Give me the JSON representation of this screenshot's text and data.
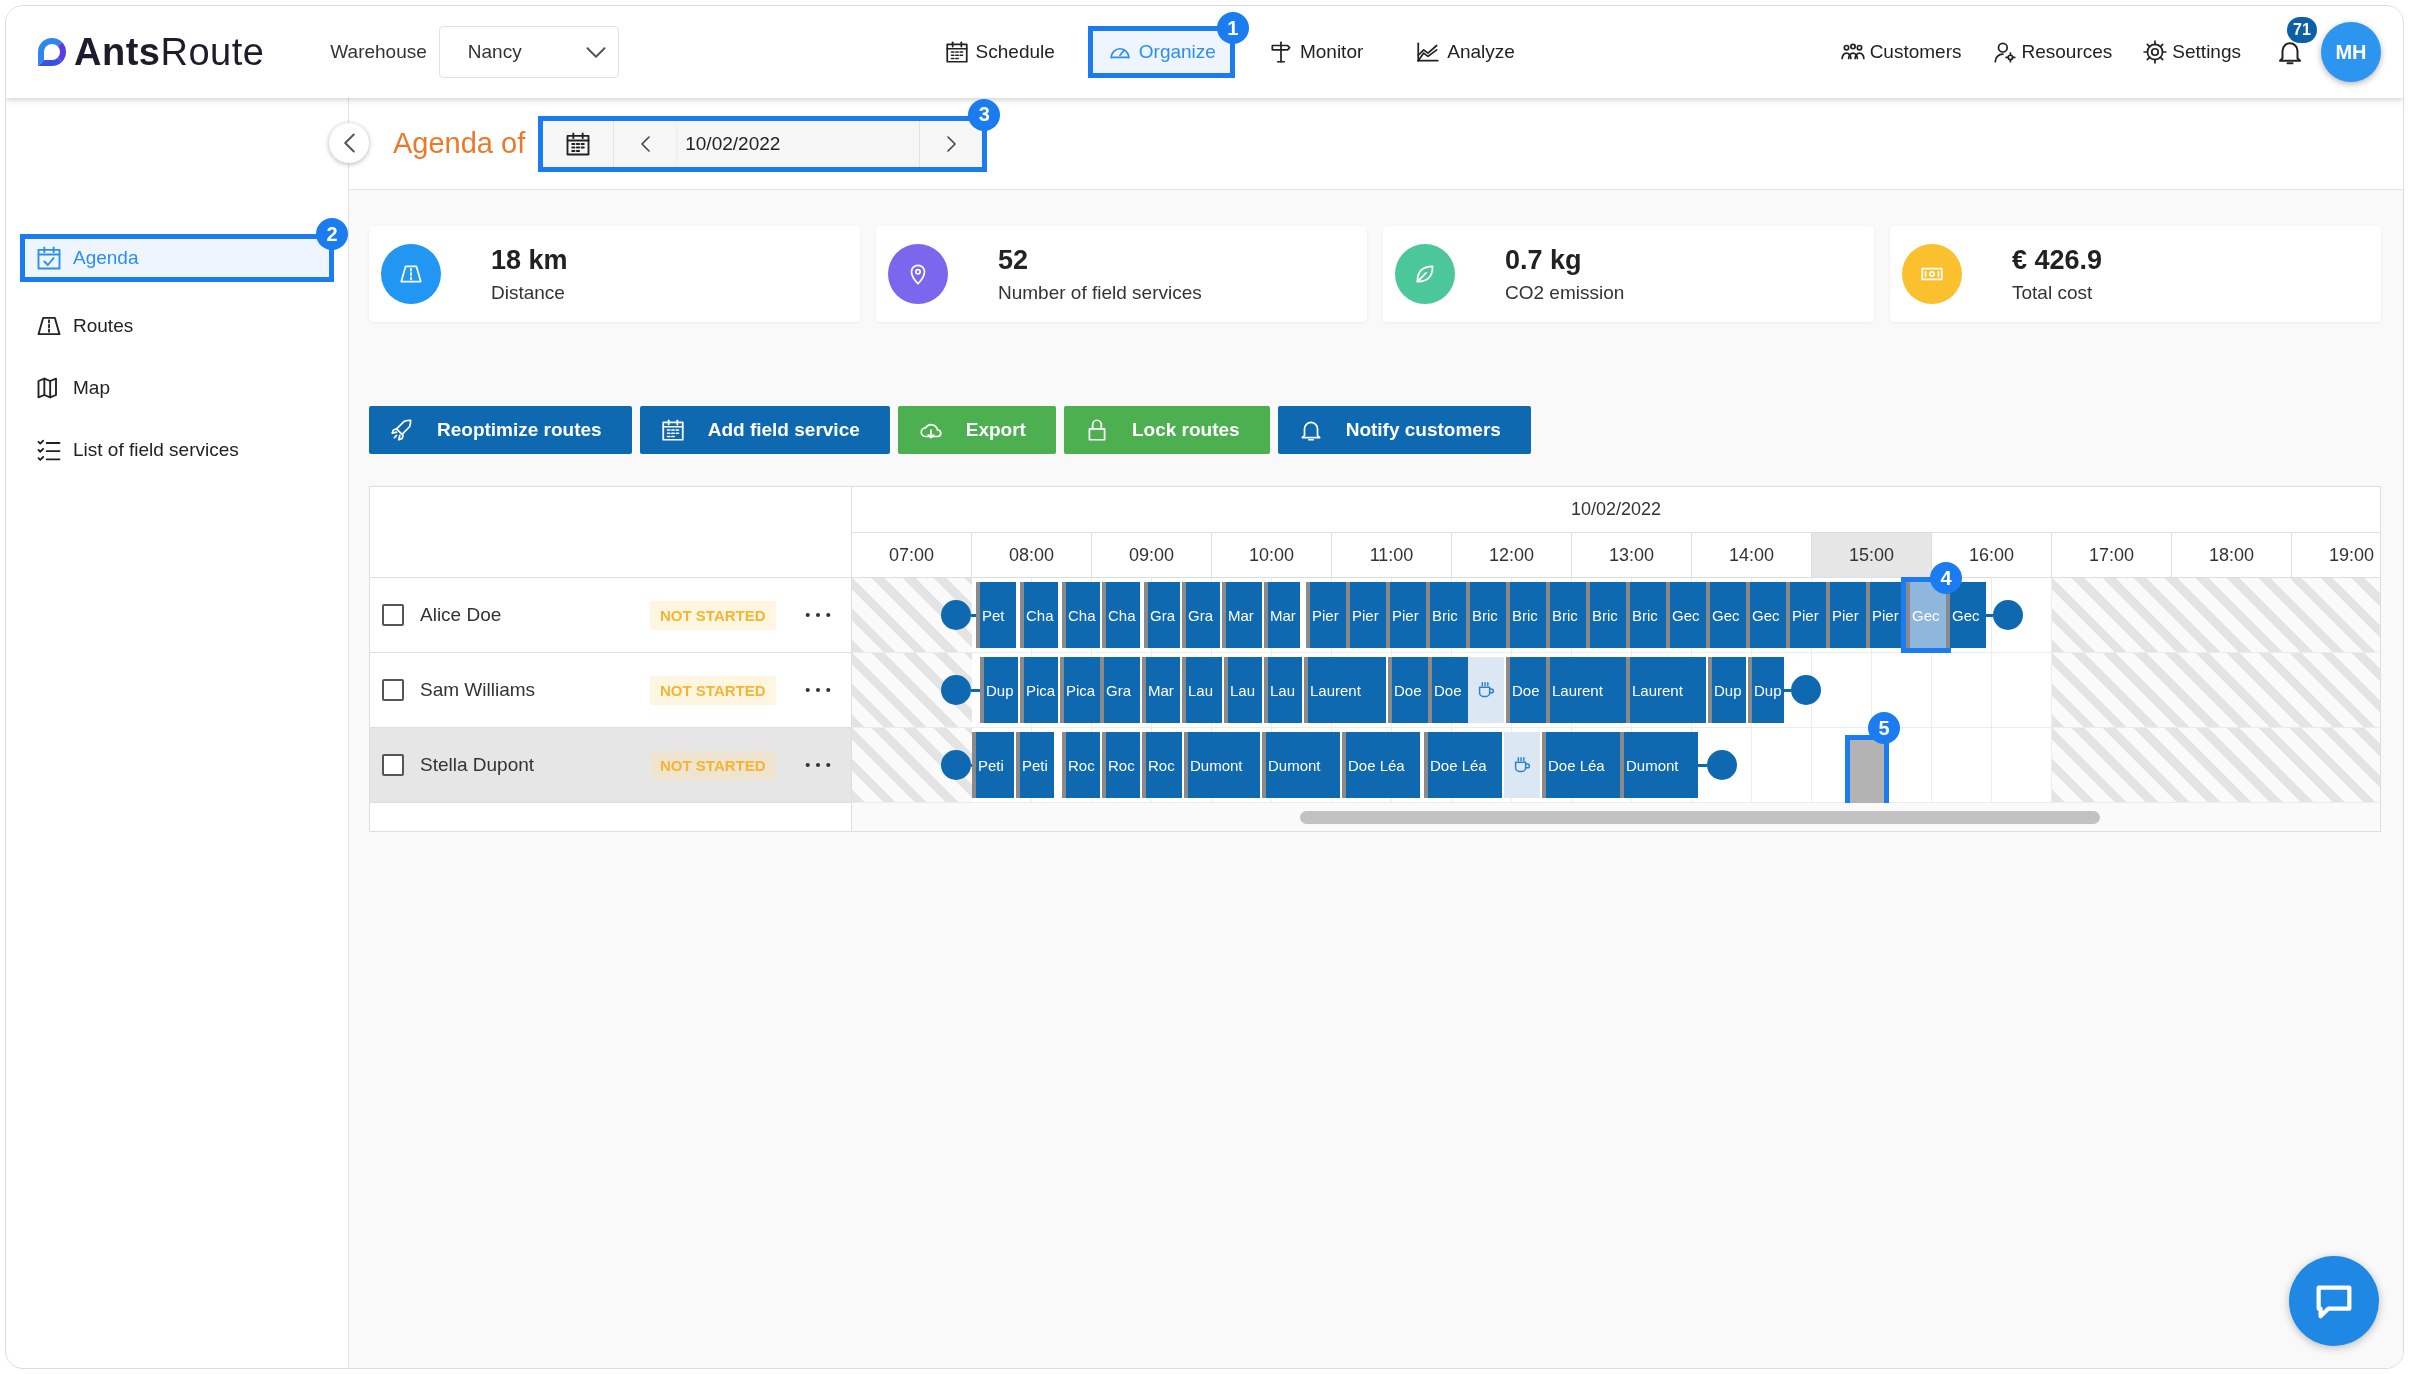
{
  "header": {
    "logo": "**Ants**Route",
    "warehouse": {
      "label": "Warehouse",
      "value": "Nancy"
    },
    "nav": [
      {
        "label": "Schedule",
        "selected": false
      },
      {
        "label": "Organize",
        "selected": true,
        "callout": "1"
      },
      {
        "label": "Monitor",
        "selected": false
      },
      {
        "label": "Analyze",
        "selected": false
      }
    ],
    "tools": [
      {
        "label": "Customers"
      },
      {
        "label": "Resources"
      },
      {
        "label": "Settings"
      }
    ],
    "notifications": "71",
    "avatar": "MH"
  },
  "sidebar": {
    "items": [
      {
        "label": "Agenda",
        "selected": true,
        "callout": "2"
      },
      {
        "label": "Routes",
        "selected": false
      },
      {
        "label": "Map",
        "selected": false
      },
      {
        "label": "List of field services",
        "selected": false
      }
    ]
  },
  "agenda": {
    "title": "Agenda of",
    "date": "10/02/2022",
    "callout": "3"
  },
  "stats": [
    {
      "value": "18 km",
      "label": "Distance",
      "color": "#2196f3"
    },
    {
      "value": "52",
      "label": "Number of field services",
      "color": "#7a67ee"
    },
    {
      "value": "0.7 kg",
      "label": "CO2 emission",
      "color": "#4cc79a"
    },
    {
      "value": "€ 426.9",
      "label": "Total cost",
      "color": "#fbc02d"
    }
  ],
  "actions": [
    {
      "label": "Reoptimize routes",
      "kind": "primary"
    },
    {
      "label": "Add field service",
      "kind": "primary"
    },
    {
      "label": "Export",
      "kind": "success"
    },
    {
      "label": "Lock routes",
      "kind": "success"
    },
    {
      "label": "Notify customers",
      "kind": "primary"
    }
  ],
  "timeline": {
    "date": "10/02/2022",
    "hours": [
      {
        "label": "07:00",
        "selected": false
      },
      {
        "label": "08:00",
        "selected": false
      },
      {
        "label": "09:00",
        "selected": false
      },
      {
        "label": "10:00",
        "selected": false
      },
      {
        "label": "11:00",
        "selected": false
      },
      {
        "label": "12:00",
        "selected": false
      },
      {
        "label": "13:00",
        "selected": false
      },
      {
        "label": "14:00",
        "selected": false
      },
      {
        "label": "15:00",
        "selected": true
      },
      {
        "label": "16:00",
        "selected": false
      },
      {
        "label": "17:00",
        "selected": false
      },
      {
        "label": "18:00",
        "selected": false
      },
      {
        "label": "19:00",
        "selected": false
      }
    ],
    "rows": [
      {
        "name": "Alice Doe",
        "status": "NOT STARTED",
        "checked": false,
        "selected": false,
        "stops": [
          {
            "label": "Pet",
            "kind": "visit"
          },
          {
            "label": "Cha",
            "kind": "visit"
          },
          {
            "label": "Cha",
            "kind": "visit"
          },
          {
            "label": "Cha",
            "kind": "visit"
          },
          {
            "label": "Gra",
            "kind": "visit"
          },
          {
            "label": "Gra",
            "kind": "visit"
          },
          {
            "label": "Mar",
            "kind": "visit"
          },
          {
            "label": "Mar",
            "kind": "visit"
          },
          {
            "label": "Pier",
            "kind": "visit"
          },
          {
            "label": "Pier",
            "kind": "visit"
          },
          {
            "label": "Pier",
            "kind": "visit"
          },
          {
            "label": "Bric",
            "kind": "visit"
          },
          {
            "label": "Bric",
            "kind": "visit"
          },
          {
            "label": "Bric",
            "kind": "visit"
          },
          {
            "label": "Bric",
            "kind": "visit"
          },
          {
            "label": "Bric",
            "kind": "visit"
          },
          {
            "label": "Bric",
            "kind": "visit"
          },
          {
            "label": "Gec",
            "kind": "visit"
          },
          {
            "label": "Gec",
            "kind": "visit"
          },
          {
            "label": "Gec",
            "kind": "visit"
          },
          {
            "label": "Pier",
            "kind": "visit"
          },
          {
            "label": "Pier",
            "kind": "visit"
          },
          {
            "label": "Pier",
            "kind": "visit"
          },
          {
            "label": "Gec",
            "kind": "highlight",
            "callout": "4"
          },
          {
            "label": "Gec",
            "kind": "visit"
          }
        ]
      },
      {
        "name": "Sam Williams",
        "status": "NOT STARTED",
        "checked": false,
        "selected": false,
        "stops": [
          {
            "label": "Dup",
            "kind": "visit"
          },
          {
            "label": "Pica",
            "kind": "visit"
          },
          {
            "label": "Pica",
            "kind": "visit"
          },
          {
            "label": "Gra",
            "kind": "visit"
          },
          {
            "label": "Mar",
            "kind": "visit"
          },
          {
            "label": "Lau",
            "kind": "visit"
          },
          {
            "label": "Lau",
            "kind": "visit"
          },
          {
            "label": "Lau",
            "kind": "visit"
          },
          {
            "label": "Laurent",
            "kind": "visit"
          },
          {
            "label": "Doe",
            "kind": "visit"
          },
          {
            "label": "Doe",
            "kind": "visit"
          },
          {
            "kind": "break"
          },
          {
            "label": "Doe",
            "kind": "visit"
          },
          {
            "label": "Laurent",
            "kind": "visit"
          },
          {
            "label": "Laurent",
            "kind": "visit"
          },
          {
            "label": "Dup",
            "kind": "visit"
          },
          {
            "label": "Dup",
            "kind": "visit"
          }
        ]
      },
      {
        "name": "Stella Dupont",
        "status": "NOT STARTED",
        "checked": false,
        "selected": true,
        "stops": [
          {
            "label": "Peti",
            "kind": "visit"
          },
          {
            "label": "Peti",
            "kind": "visit"
          },
          {
            "label": "Roc",
            "kind": "visit"
          },
          {
            "label": "Roc",
            "kind": "visit"
          },
          {
            "label": "Roc",
            "kind": "visit"
          },
          {
            "label": "Dumont",
            "kind": "visit"
          },
          {
            "label": "Dumont",
            "kind": "visit"
          },
          {
            "label": "Doe Léa",
            "kind": "visit"
          },
          {
            "label": "Doe Léa",
            "kind": "visit"
          },
          {
            "kind": "break"
          },
          {
            "label": "Doe Léa",
            "kind": "visit"
          },
          {
            "label": "Dumont",
            "kind": "visit"
          },
          {
            "kind": "ghost",
            "callout": "5"
          }
        ]
      }
    ]
  }
}
